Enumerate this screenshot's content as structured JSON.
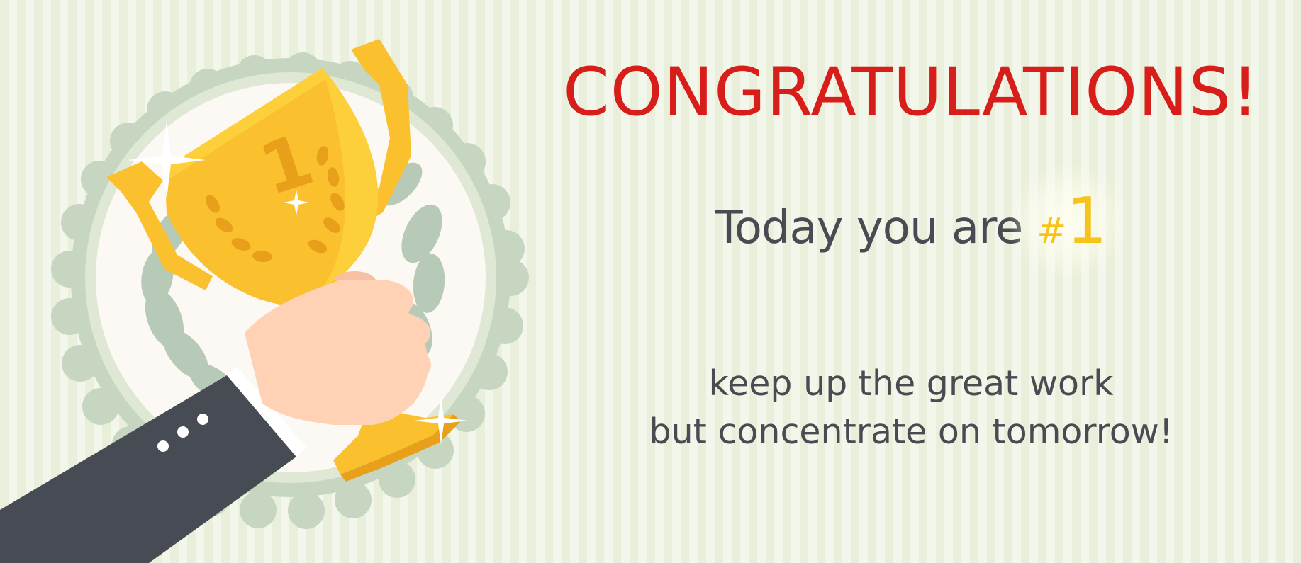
{
  "banner": {
    "title": "CONGRATULATIONS!",
    "rank": {
      "prefix": "Today you are",
      "hash": "#",
      "number": "1"
    },
    "message": {
      "line1": "keep up the great work",
      "line2": "but concentrate on tomorrow!"
    }
  },
  "trophy": {
    "number": "1"
  },
  "icons": {
    "illustration": "trophy-in-hand-icon",
    "badge": "scalloped-badge-icon",
    "laurel": "laurel-wreath-icon",
    "sparkle": "sparkle-icon"
  },
  "colors": {
    "background": "#e9efda",
    "background_stripe": "#f3f6ea",
    "title": "#d81e1b",
    "text": "#474c52",
    "accent_gold": "#f6c21c",
    "trophy_gold": "#fbc02d",
    "trophy_shadow": "#e8a01a",
    "sleeve": "#474b53",
    "skin": "#ffd2b5",
    "badge_outer": "#c7d6c1",
    "badge_inner": "#fcf8f3",
    "leaf": "#b7cab8"
  }
}
